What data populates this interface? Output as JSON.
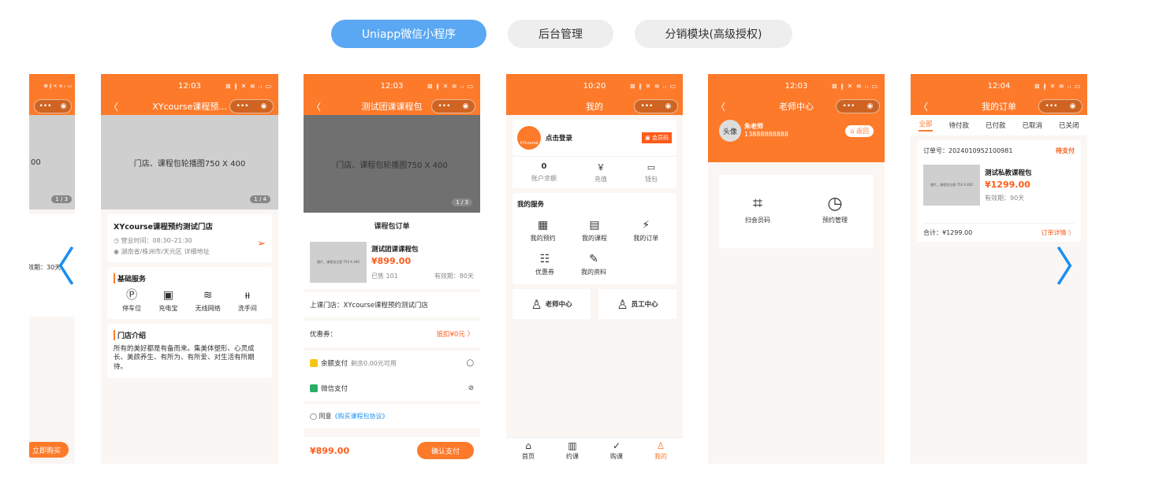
{
  "tabs": [
    {
      "label": "Uniapp微信小程序",
      "active": true
    },
    {
      "label": "后台管理",
      "active": false
    },
    {
      "label": "分销模块(高级授权)",
      "active": false
    }
  ],
  "arrows": {
    "left": "〈",
    "right": "〉"
  },
  "status_icons": "⊠ ∦ ✕ ≋ ᵢₗ ▭",
  "capsule": {
    "dots": "•••",
    "circle": "◉"
  },
  "p0": {
    "buy": "立即购买",
    "partial_text": "00",
    "validity": "效期：30天",
    "page": "1 / 3"
  },
  "p1": {
    "time": "12:03",
    "title": "XYcourse课程预...",
    "banner": "门店、课程包轮播图750 X 400",
    "page": "1 / 4",
    "store_name": "XYcourse课程预约测试门店",
    "hours": "◷ 营业时间：08:30–21:30",
    "address": "◉ 湖南省/株洲市/天元区 详细地址",
    "facilities_title": "基础服务",
    "facilities": [
      {
        "icon": "Ⓟ",
        "label": "停车位"
      },
      {
        "icon": "▣",
        "label": "充电宝"
      },
      {
        "icon": "≋",
        "label": "无线网络"
      },
      {
        "icon": "ᵼᵼ",
        "label": "洗手间"
      }
    ],
    "intro_title": "门店介绍",
    "intro_text": "所有的美好都是有备而来。集美体塑形、心灵成长、美颜养生、有所为、有所爱、对生活有所期待。"
  },
  "p2": {
    "time": "12:03",
    "title": "测试团课课程包",
    "banner": "门店、课程包轮播图750 X 400",
    "page": "1 / 3",
    "order_title": "课程包订单",
    "item_name": "测试团课课程包",
    "item_price": "¥899.00",
    "sold": "已售 101",
    "validity": "有效期：80天",
    "thumb_text": "图片，课程包主图 750 X 400",
    "store": "上课门店：XYcourse课程预约测试门店",
    "coupon_label": "优惠券：",
    "coupon_value": "抵扣¥0元 〉",
    "pay1": "余额支付",
    "pay1_note": "剩余0.00元可用",
    "pay2": "微信支付",
    "agree_prefix": "◯ 同意",
    "agree_link": "《购买课程包协议》",
    "total": "¥899.00",
    "confirm": "确认支付"
  },
  "p3": {
    "time": "10:20",
    "title": "我的",
    "logo": "XYcourse",
    "login": "点击登录",
    "vip": "▣ 会员码",
    "stats": [
      {
        "icon": "0",
        "label": "账户余额"
      },
      {
        "icon": "￥",
        "label": "充值"
      },
      {
        "icon": "▭",
        "label": "钱包"
      }
    ],
    "services_title": "我的服务",
    "services": [
      {
        "icon": "▦",
        "label": "我的预约"
      },
      {
        "icon": "▤",
        "label": "我的课程"
      },
      {
        "icon": "⚡",
        "label": "我的订单"
      },
      {
        "icon": "☷",
        "label": "优惠券"
      },
      {
        "icon": "✎",
        "label": "我的资料"
      }
    ],
    "teacher": "老师中心",
    "staff": "员工中心",
    "tabbar": [
      {
        "icon": "⌂",
        "label": "首页"
      },
      {
        "icon": "▥",
        "label": "约课"
      },
      {
        "icon": "✓",
        "label": "购课"
      },
      {
        "icon": "♙",
        "label": "我的"
      }
    ]
  },
  "p4": {
    "time": "12:03",
    "title": "老师中心",
    "avatar": "头像",
    "name": "朱老师",
    "phone": "13888888888",
    "back": "⌂ 返回",
    "actions": [
      {
        "icon": "⌗",
        "label": "扫会员码"
      },
      {
        "icon": "◷",
        "label": "预约管理"
      }
    ]
  },
  "p5": {
    "time": "12:04",
    "title": "我的订单",
    "tabs": [
      "全部",
      "待付款",
      "已付款",
      "已取消",
      "已关闭"
    ],
    "order_no": "订单号：2024010952100981",
    "order_status": "待支付",
    "item_name": "测试私教课程包",
    "item_price": "¥1299.00",
    "validity": "有效期：90天",
    "thumb_text": "图片，课程包主图 750 X 400",
    "total": "合计：¥1299.00",
    "detail": "订单详情 〉"
  }
}
